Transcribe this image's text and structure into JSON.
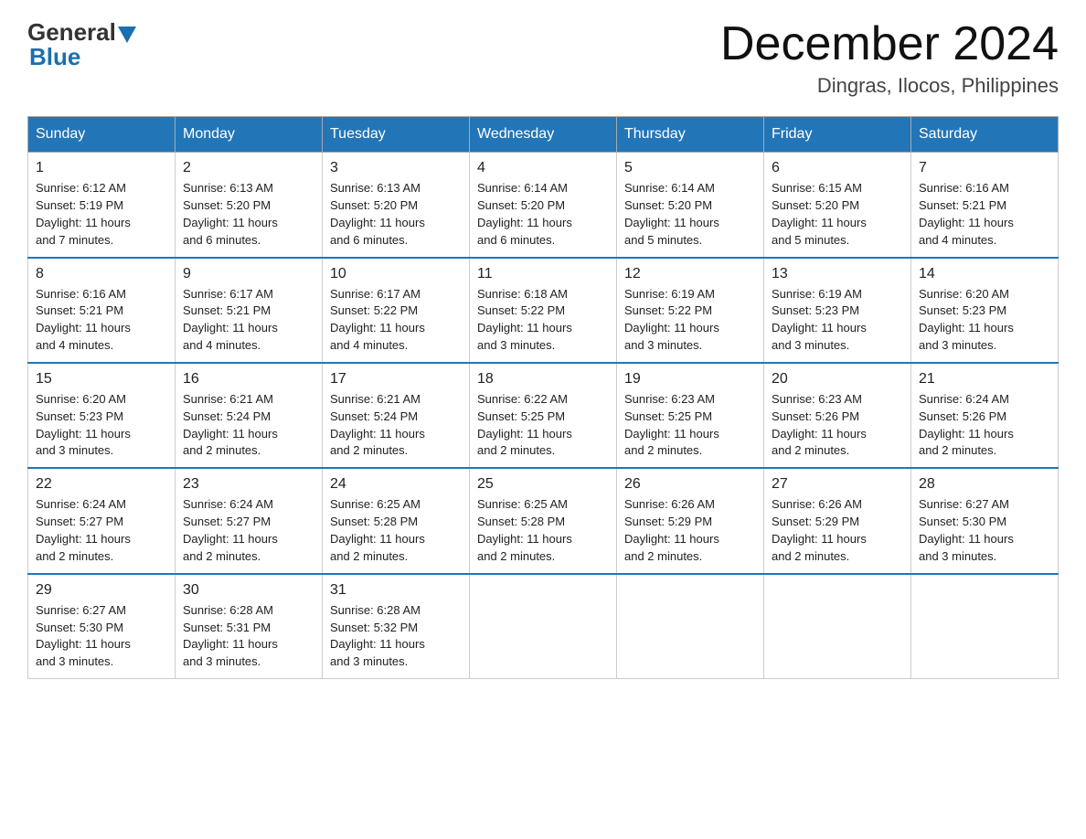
{
  "header": {
    "logo_general": "General",
    "logo_blue": "Blue",
    "month_title": "December 2024",
    "location": "Dingras, Ilocos, Philippines"
  },
  "weekdays": [
    "Sunday",
    "Monday",
    "Tuesday",
    "Wednesday",
    "Thursday",
    "Friday",
    "Saturday"
  ],
  "weeks": [
    [
      {
        "day": "1",
        "sunrise": "6:12 AM",
        "sunset": "5:19 PM",
        "daylight": "11 hours and 7 minutes."
      },
      {
        "day": "2",
        "sunrise": "6:13 AM",
        "sunset": "5:20 PM",
        "daylight": "11 hours and 6 minutes."
      },
      {
        "day": "3",
        "sunrise": "6:13 AM",
        "sunset": "5:20 PM",
        "daylight": "11 hours and 6 minutes."
      },
      {
        "day": "4",
        "sunrise": "6:14 AM",
        "sunset": "5:20 PM",
        "daylight": "11 hours and 6 minutes."
      },
      {
        "day": "5",
        "sunrise": "6:14 AM",
        "sunset": "5:20 PM",
        "daylight": "11 hours and 5 minutes."
      },
      {
        "day": "6",
        "sunrise": "6:15 AM",
        "sunset": "5:20 PM",
        "daylight": "11 hours and 5 minutes."
      },
      {
        "day": "7",
        "sunrise": "6:16 AM",
        "sunset": "5:21 PM",
        "daylight": "11 hours and 4 minutes."
      }
    ],
    [
      {
        "day": "8",
        "sunrise": "6:16 AM",
        "sunset": "5:21 PM",
        "daylight": "11 hours and 4 minutes."
      },
      {
        "day": "9",
        "sunrise": "6:17 AM",
        "sunset": "5:21 PM",
        "daylight": "11 hours and 4 minutes."
      },
      {
        "day": "10",
        "sunrise": "6:17 AM",
        "sunset": "5:22 PM",
        "daylight": "11 hours and 4 minutes."
      },
      {
        "day": "11",
        "sunrise": "6:18 AM",
        "sunset": "5:22 PM",
        "daylight": "11 hours and 3 minutes."
      },
      {
        "day": "12",
        "sunrise": "6:19 AM",
        "sunset": "5:22 PM",
        "daylight": "11 hours and 3 minutes."
      },
      {
        "day": "13",
        "sunrise": "6:19 AM",
        "sunset": "5:23 PM",
        "daylight": "11 hours and 3 minutes."
      },
      {
        "day": "14",
        "sunrise": "6:20 AM",
        "sunset": "5:23 PM",
        "daylight": "11 hours and 3 minutes."
      }
    ],
    [
      {
        "day": "15",
        "sunrise": "6:20 AM",
        "sunset": "5:23 PM",
        "daylight": "11 hours and 3 minutes."
      },
      {
        "day": "16",
        "sunrise": "6:21 AM",
        "sunset": "5:24 PM",
        "daylight": "11 hours and 2 minutes."
      },
      {
        "day": "17",
        "sunrise": "6:21 AM",
        "sunset": "5:24 PM",
        "daylight": "11 hours and 2 minutes."
      },
      {
        "day": "18",
        "sunrise": "6:22 AM",
        "sunset": "5:25 PM",
        "daylight": "11 hours and 2 minutes."
      },
      {
        "day": "19",
        "sunrise": "6:23 AM",
        "sunset": "5:25 PM",
        "daylight": "11 hours and 2 minutes."
      },
      {
        "day": "20",
        "sunrise": "6:23 AM",
        "sunset": "5:26 PM",
        "daylight": "11 hours and 2 minutes."
      },
      {
        "day": "21",
        "sunrise": "6:24 AM",
        "sunset": "5:26 PM",
        "daylight": "11 hours and 2 minutes."
      }
    ],
    [
      {
        "day": "22",
        "sunrise": "6:24 AM",
        "sunset": "5:27 PM",
        "daylight": "11 hours and 2 minutes."
      },
      {
        "day": "23",
        "sunrise": "6:24 AM",
        "sunset": "5:27 PM",
        "daylight": "11 hours and 2 minutes."
      },
      {
        "day": "24",
        "sunrise": "6:25 AM",
        "sunset": "5:28 PM",
        "daylight": "11 hours and 2 minutes."
      },
      {
        "day": "25",
        "sunrise": "6:25 AM",
        "sunset": "5:28 PM",
        "daylight": "11 hours and 2 minutes."
      },
      {
        "day": "26",
        "sunrise": "6:26 AM",
        "sunset": "5:29 PM",
        "daylight": "11 hours and 2 minutes."
      },
      {
        "day": "27",
        "sunrise": "6:26 AM",
        "sunset": "5:29 PM",
        "daylight": "11 hours and 2 minutes."
      },
      {
        "day": "28",
        "sunrise": "6:27 AM",
        "sunset": "5:30 PM",
        "daylight": "11 hours and 3 minutes."
      }
    ],
    [
      {
        "day": "29",
        "sunrise": "6:27 AM",
        "sunset": "5:30 PM",
        "daylight": "11 hours and 3 minutes."
      },
      {
        "day": "30",
        "sunrise": "6:28 AM",
        "sunset": "5:31 PM",
        "daylight": "11 hours and 3 minutes."
      },
      {
        "day": "31",
        "sunrise": "6:28 AM",
        "sunset": "5:32 PM",
        "daylight": "11 hours and 3 minutes."
      },
      null,
      null,
      null,
      null
    ]
  ],
  "labels": {
    "sunrise": "Sunrise:",
    "sunset": "Sunset:",
    "daylight": "Daylight:"
  }
}
